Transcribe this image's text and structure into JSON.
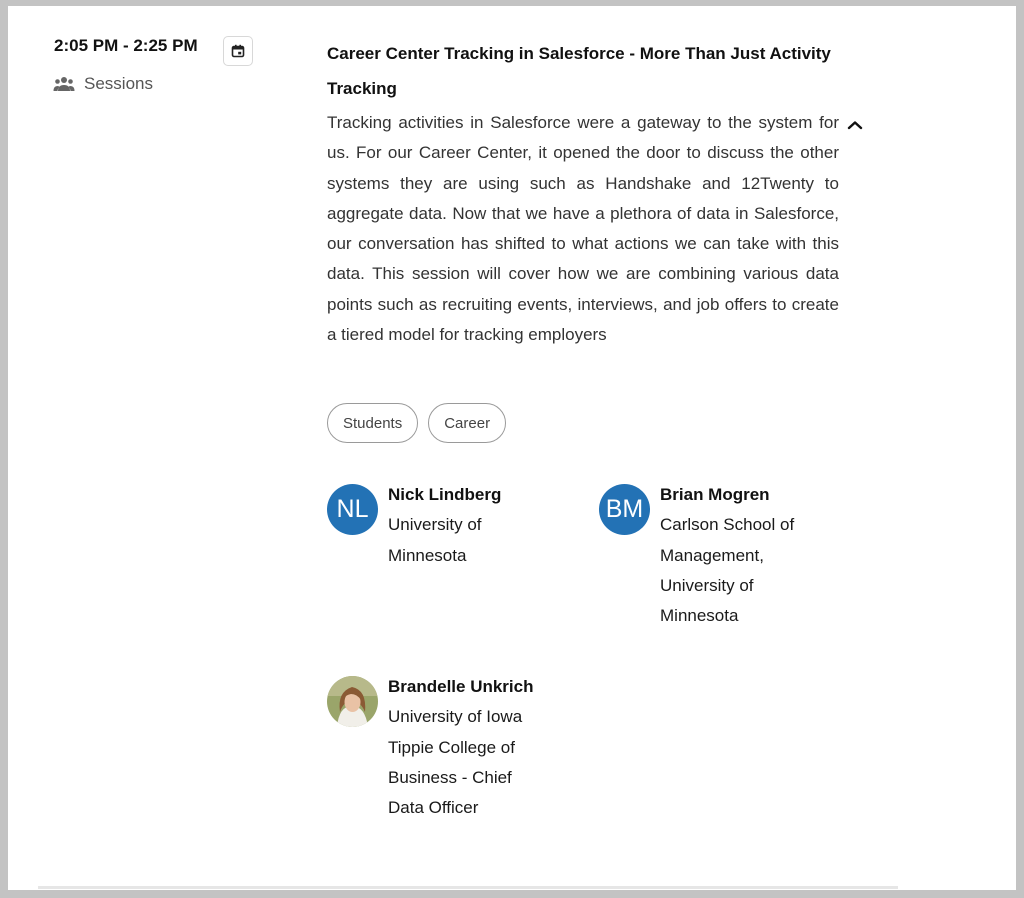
{
  "session": {
    "time": "2:05 PM - 2:25 PM",
    "type_label": "Sessions",
    "title": "Career Center Tracking in Salesforce - More Than Just Activity Tracking",
    "description": "Tracking activities in Salesforce were a gateway to the system for us. For our Career Center, it opened the door to discuss the other systems they are using such as Handshake and 12Twenty to aggregate data. Now that we have a plethora of data in Salesforce, our conversation has shifted to what actions we can take with this data. This session will cover how we are combining various data points such as recruiting events, interviews, and job offers to create a tiered model for tracking employers",
    "tags": [
      "Students",
      "Career"
    ]
  },
  "icons": {
    "calendar": "calendar-icon",
    "sessions": "group-icon",
    "collapse": "chevron-up-icon"
  },
  "speakers": [
    {
      "initials": "NL",
      "name": "Nick Lindberg",
      "org": "University of\nMinnesota"
    },
    {
      "initials": "BM",
      "name": "Brian Mogren",
      "org": "Carlson School of\nManagement,\nUniversity of\nMinnesota"
    },
    {
      "initials": "",
      "name": "Brandelle Unkrich",
      "org": "University of Iowa\nTippie College of\nBusiness - Chief\nData Officer"
    }
  ],
  "colors": {
    "avatar_blue": "#2372b5",
    "tag_border": "#9a9a9a",
    "text_muted": "#555555"
  }
}
